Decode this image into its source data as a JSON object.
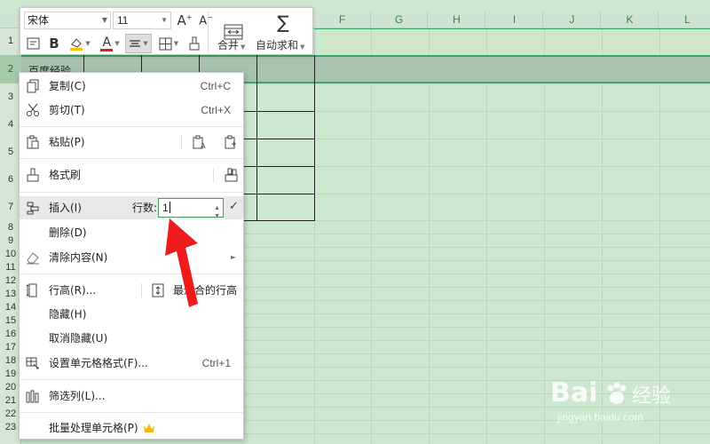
{
  "columns": [
    "F",
    "G",
    "H",
    "I",
    "J",
    "K",
    "L"
  ],
  "rows": [
    "1",
    "2",
    "3",
    "4",
    "5",
    "6",
    "7",
    "8",
    "9",
    "10",
    "11",
    "12",
    "13",
    "14",
    "15",
    "16",
    "17",
    "18",
    "19",
    "20",
    "21",
    "22",
    "23"
  ],
  "cell_b2": "百度经验",
  "toolbar": {
    "font_name": "宋体",
    "font_size": "11",
    "merge_label": "合并",
    "autosum_label": "自动求和",
    "bold_label": "B",
    "font_color_label": "A"
  },
  "context_menu": {
    "copy": {
      "label": "复制(C)",
      "shortcut": "Ctrl+C"
    },
    "cut": {
      "label": "剪切(T)",
      "shortcut": "Ctrl+X"
    },
    "paste": {
      "label": "粘贴(P)"
    },
    "format_painter": {
      "label": "格式刷"
    },
    "insert": {
      "label": "插入(I)",
      "rows_label": "行数:",
      "rows_value": "1"
    },
    "delete": {
      "label": "删除(D)"
    },
    "clear": {
      "label": "清除内容(N)"
    },
    "row_height": {
      "label": "行高(R)...",
      "best_fit_label": "最适合的行高"
    },
    "hide": {
      "label": "隐藏(H)"
    },
    "unhide": {
      "label": "取消隐藏(U)"
    },
    "format_cells": {
      "label": "设置单元格格式(F)...",
      "shortcut": "Ctrl+1"
    },
    "filter": {
      "label": "筛选列(L)..."
    },
    "batch": {
      "label": "批量处理单元格(P)"
    }
  },
  "watermark": {
    "brand_a": "Bai",
    "brand_b": "经验",
    "url": "jingyan.baidu.com"
  },
  "colors": {
    "accent": "#3aa865",
    "arrow": "#ee1c1c",
    "crown": "#f5b90e"
  }
}
